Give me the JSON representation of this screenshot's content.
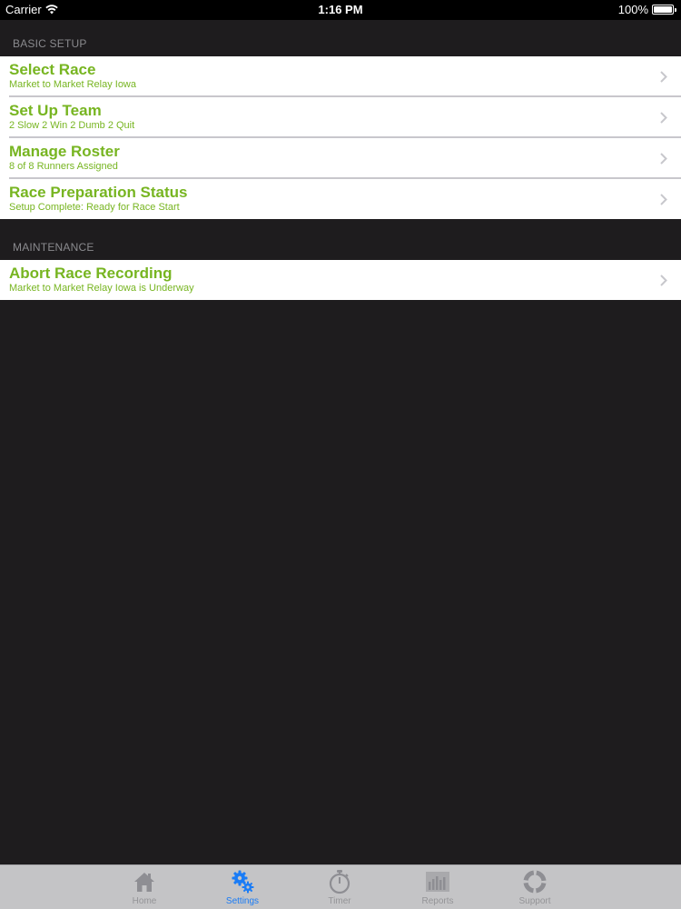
{
  "status_bar": {
    "carrier": "Carrier",
    "time": "1:16 PM",
    "battery": "100%"
  },
  "sections": {
    "basic_setup": {
      "header": "BASIC SETUP",
      "items": [
        {
          "title": "Select Race",
          "subtitle": "Market to Market Relay Iowa"
        },
        {
          "title": "Set Up Team",
          "subtitle": "2 Slow 2 Win 2 Dumb 2 Quit"
        },
        {
          "title": "Manage Roster",
          "subtitle": "8 of 8 Runners Assigned"
        },
        {
          "title": "Race Preparation Status",
          "subtitle": "Setup Complete: Ready for Race Start"
        }
      ]
    },
    "maintenance": {
      "header": "MAINTENANCE",
      "items": [
        {
          "title": "Abort Race Recording",
          "subtitle": "Market to Market Relay Iowa is Underway"
        }
      ]
    }
  },
  "tab_bar": {
    "tabs": [
      {
        "label": "Home",
        "icon": "house-icon"
      },
      {
        "label": "Settings",
        "icon": "gears-icon",
        "active": true
      },
      {
        "label": "Timer",
        "icon": "stopwatch-icon"
      },
      {
        "label": "Reports",
        "icon": "bar-chart-icon"
      },
      {
        "label": "Support",
        "icon": "lifebuoy-icon"
      }
    ]
  },
  "colors": {
    "accent_green": "#77b521",
    "active_tab_blue": "#1a7cf6",
    "background": "#1e1c1e",
    "tab_bar": "#c4c4c6"
  }
}
